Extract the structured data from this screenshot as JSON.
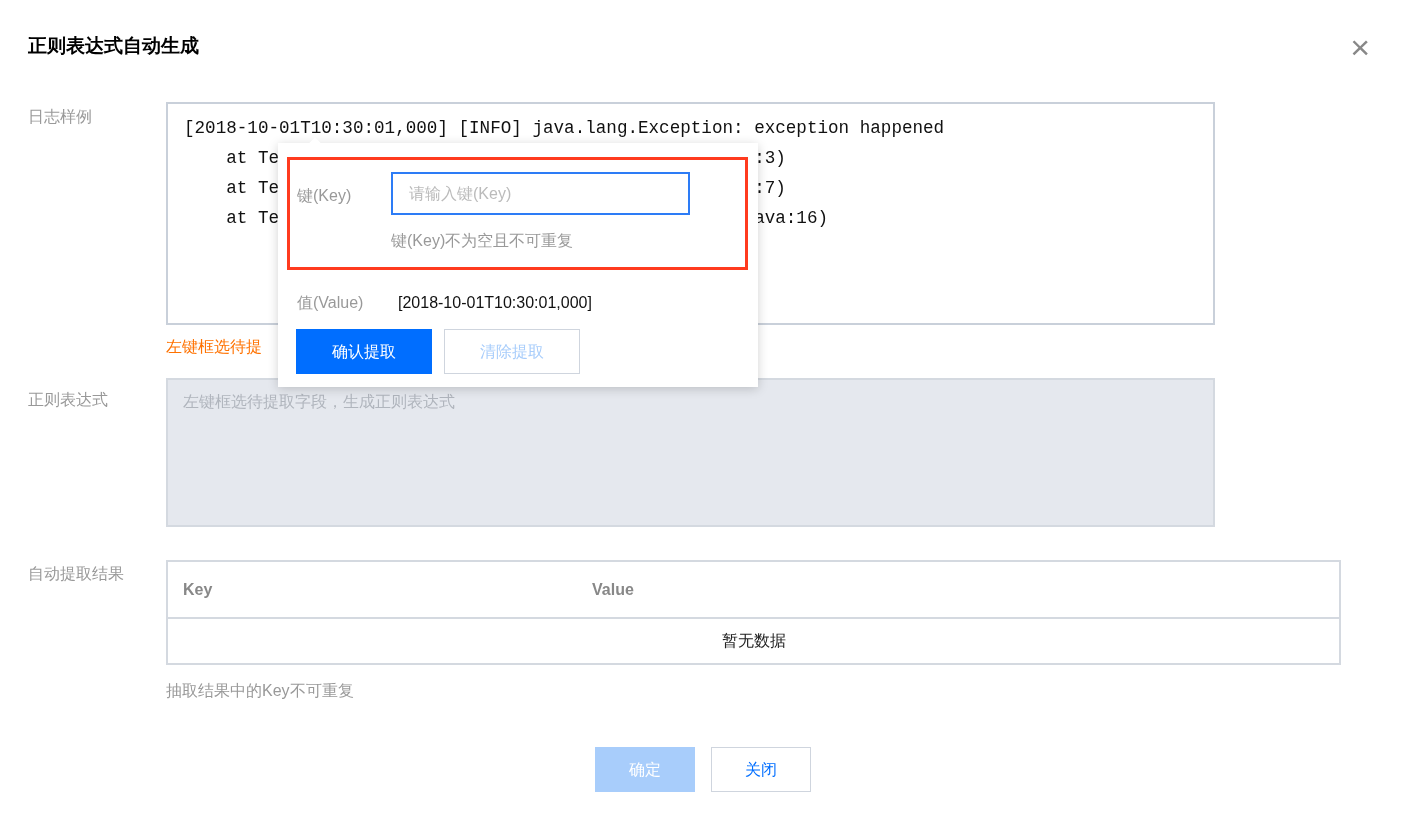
{
  "dialog": {
    "title": "正则表达式自动生成",
    "close": "×"
  },
  "log_sample": {
    "label": "日志样例",
    "lines": [
      {
        "text": "[2018-10-01T10:30:01,000] [INFO] java.lang.Exception: exception happened"
      },
      {
        "text": "    at Te",
        "tail": ":3)"
      },
      {
        "text": "    at Te",
        "tail": ":7)"
      },
      {
        "text": "    at Te",
        "tail": "ava:16)"
      }
    ],
    "hint": "左键框选待提"
  },
  "popup": {
    "key_label": "键(Key)",
    "key_input": {
      "placeholder": "请输入键(Key)",
      "focused": true
    },
    "key_help": "键(Key)不为空且不可重复",
    "value_label": "值(Value)",
    "value": "[2018-10-01T10:30:01,000]",
    "highlighted": true,
    "buttons": [
      {
        "label": "确认提取",
        "kind": "primary",
        "disabled": false
      },
      {
        "label": "清除提取",
        "kind": "secondary",
        "disabled": true
      }
    ]
  },
  "regex": {
    "label": "正则表达式",
    "placeholder": "左键框选待提取字段，生成正则表达式"
  },
  "results": {
    "label": "自动提取结果",
    "columns": [
      "Key",
      "Value"
    ],
    "empty_text": "暂无数据",
    "note": "抽取结果中的Key不可重复"
  },
  "footer": {
    "buttons": [
      {
        "label": "确定",
        "kind": "primary",
        "disabled": true
      },
      {
        "label": "关闭",
        "kind": "secondary",
        "disabled": false
      }
    ]
  }
}
